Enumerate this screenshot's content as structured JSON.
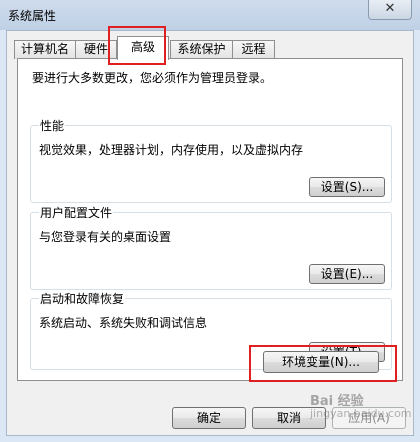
{
  "window": {
    "title": "系统属性",
    "close_glyph": "✕"
  },
  "tabs": [
    {
      "label": "计算机名"
    },
    {
      "label": "硬件"
    },
    {
      "label": "高级"
    },
    {
      "label": "系统保护"
    },
    {
      "label": "远程"
    }
  ],
  "active_tab": "高级",
  "advanced": {
    "admin_note": "要进行大多数更改，您必须作为管理员登录。",
    "performance": {
      "title": "性能",
      "description": "视觉效果，处理器计划，内存使用，以及虚拟内存",
      "button": "设置(S)..."
    },
    "user_profiles": {
      "title": "用户配置文件",
      "description": "与您登录有关的桌面设置",
      "button": "设置(E)..."
    },
    "startup_recovery": {
      "title": "启动和故障恢复",
      "description": "系统启动、系统失败和调试信息",
      "button": "设置(T)..."
    },
    "env_button": "环境变量(N)..."
  },
  "footer": {
    "ok": "确定",
    "cancel": "取消",
    "apply": "应用(A)"
  },
  "watermark": {
    "line1": "Bai 经验",
    "line2": "jingyan.baidu.com"
  },
  "colors": {
    "highlight": "#e02020",
    "title_bar": "#c7d6e9"
  }
}
